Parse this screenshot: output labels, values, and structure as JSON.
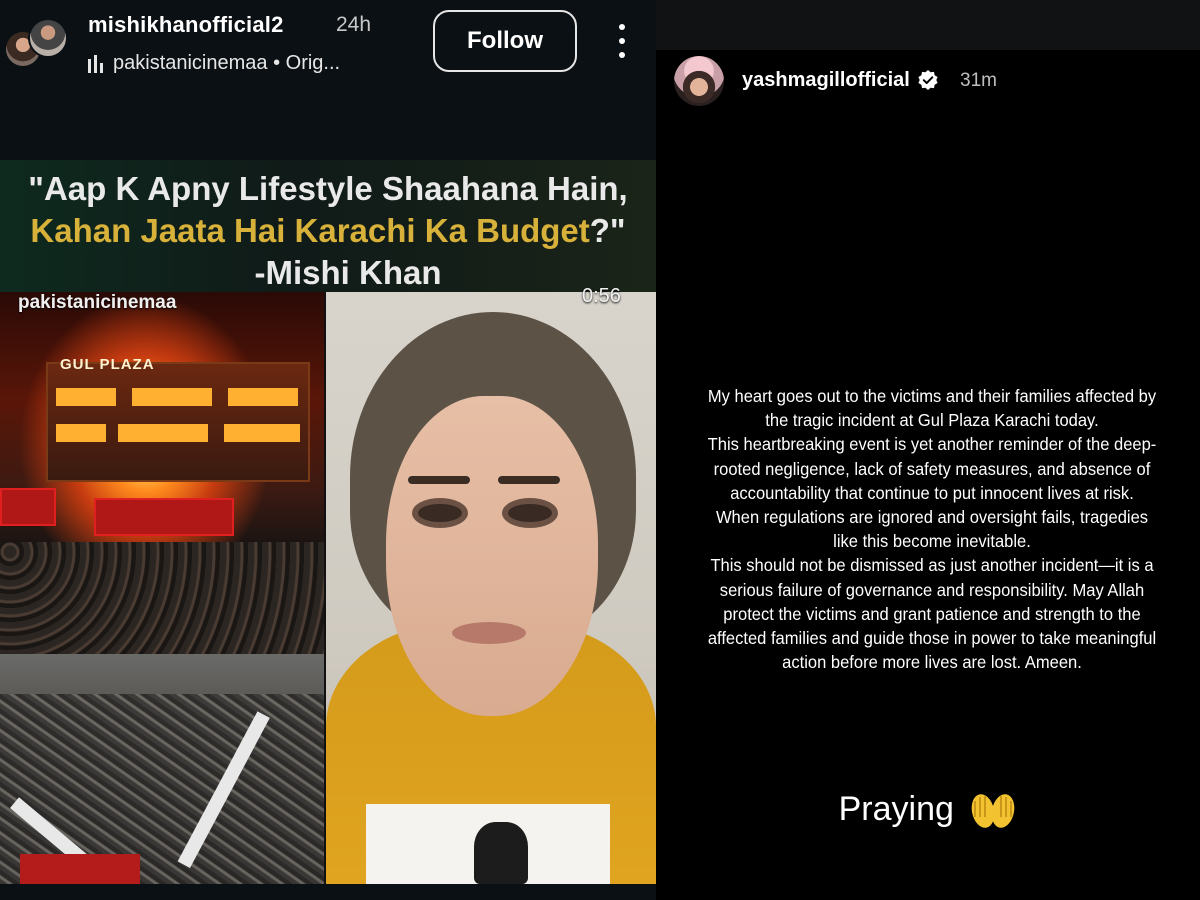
{
  "left_post": {
    "username": "mishikhanofficial2",
    "time": "24h",
    "audio": "pakistanicinemaa • Orig...",
    "follow_label": "Follow",
    "icons": [
      "avatar-pair",
      "audio-bars-icon",
      "more-options-icon"
    ],
    "video": {
      "quote_line1": "\"Aap K Apny Lifestyle  Shaahana Hain,",
      "quote_line2_gold": "Kahan Jaata Hai Karachi Ka Budget",
      "quote_line2_tail": "?\"",
      "quote_line3": "-Mishi Khan",
      "watermark": "pakistanicinemaa",
      "duration": "0:56",
      "building_sign": "GUL PLAZA"
    }
  },
  "right_story": {
    "username": "yashmagillofficial",
    "time": "31m",
    "verified_icon": "verified-badge-icon",
    "lines": [
      "My heart goes out to the victims and their families affected by",
      "the tragic incident at Gul Plaza Karachi today.",
      "This heartbreaking event is yet another reminder of the deep-",
      "rooted negligence, lack of safety measures, and absence of",
      "accountability that continue to put innocent lives at risk.",
      "When regulations are ignored and oversight fails, tragedies",
      "like this become inevitable.",
      "This should not be dismissed as just another incident—it is a",
      "serious failure of governance and responsibility. May Allah",
      "protect the victims and grant patience and strength to the",
      "affected families and guide those in power to take meaningful",
      "action before more lives are lost. Ameen."
    ],
    "praying": "Praying",
    "praying_icon": "folded-hands-icon"
  },
  "colors": {
    "gold": "#d8b13a",
    "panel_left": "#0b1014",
    "panel_right": "#000000",
    "hoodie": "#e0a420"
  }
}
